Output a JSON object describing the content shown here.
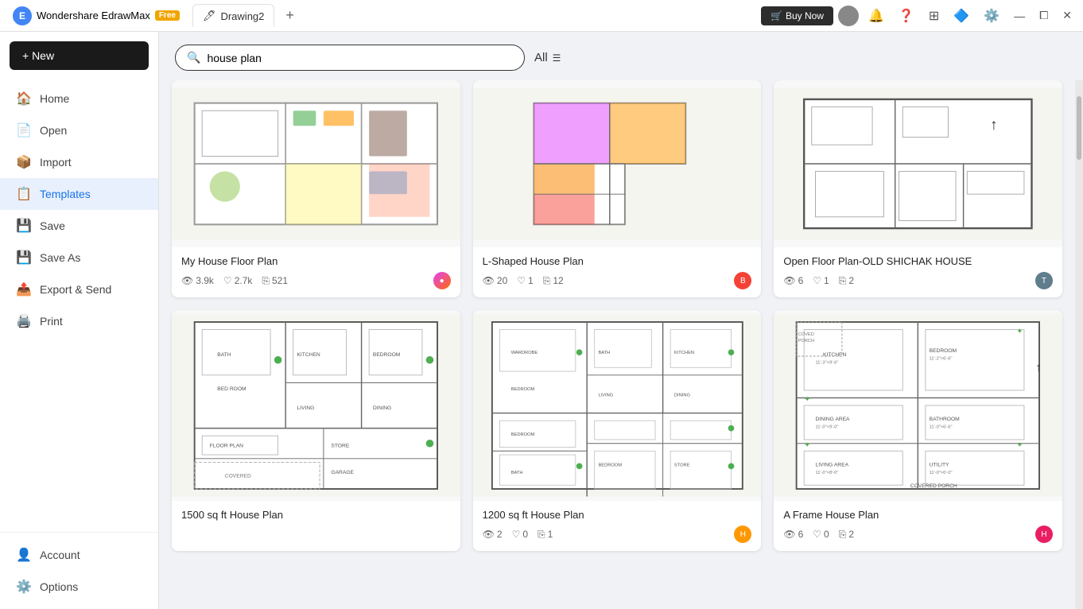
{
  "app": {
    "name": "Wondershare EdrawMax",
    "badge": "Free",
    "tab": "Drawing2",
    "buy_label": "Buy Now"
  },
  "window_controls": {
    "minimize": "—",
    "maximize": "⧠",
    "close": "✕"
  },
  "toolbar_icons": [
    "bell",
    "help",
    "grid",
    "shapes",
    "settings"
  ],
  "new_button": "+ New",
  "sidebar": {
    "items": [
      {
        "id": "home",
        "label": "Home",
        "icon": "🏠"
      },
      {
        "id": "open",
        "label": "Open",
        "icon": "📄"
      },
      {
        "id": "import",
        "label": "Import",
        "icon": "📦"
      },
      {
        "id": "templates",
        "label": "Templates",
        "icon": "📋",
        "active": true
      },
      {
        "id": "save",
        "label": "Save",
        "icon": "💾"
      },
      {
        "id": "save-as",
        "label": "Save As",
        "icon": "💾"
      },
      {
        "id": "export",
        "label": "Export & Send",
        "icon": "📤"
      },
      {
        "id": "print",
        "label": "Print",
        "icon": "🖨️"
      }
    ],
    "bottom_items": [
      {
        "id": "account",
        "label": "Account",
        "icon": "👤"
      },
      {
        "id": "options",
        "label": "Options",
        "icon": "⚙️"
      }
    ]
  },
  "search": {
    "placeholder": "house plan",
    "value": "house plan",
    "all_label": "All"
  },
  "templates": [
    {
      "id": "t1",
      "title": "My House Floor Plan",
      "views": "3.9k",
      "likes": "2.7k",
      "copies": "521",
      "avatar_color": "#9c27b0",
      "avatar_letter": ""
    },
    {
      "id": "t2",
      "title": "L-Shaped House Plan",
      "views": "20",
      "likes": "1",
      "copies": "12",
      "avatar_color": "#f44336",
      "avatar_letter": "B"
    },
    {
      "id": "t3",
      "title": "Open Floor Plan-OLD SHICHAK HOUSE",
      "views": "6",
      "likes": "1",
      "copies": "2",
      "avatar_color": "#607d8b",
      "avatar_letter": "T"
    },
    {
      "id": "t4",
      "title": "1500 sq ft House Plan",
      "views": "",
      "likes": "",
      "copies": "",
      "avatar_color": "#4caf50",
      "avatar_letter": ""
    },
    {
      "id": "t5",
      "title": "1200 sq ft House Plan",
      "views": "2",
      "likes": "0",
      "copies": "1",
      "avatar_color": "#ff9800",
      "avatar_letter": "H"
    },
    {
      "id": "t6",
      "title": "A Frame House Plan",
      "views": "6",
      "likes": "0",
      "copies": "2",
      "avatar_color": "#e91e63",
      "avatar_letter": "H"
    }
  ]
}
